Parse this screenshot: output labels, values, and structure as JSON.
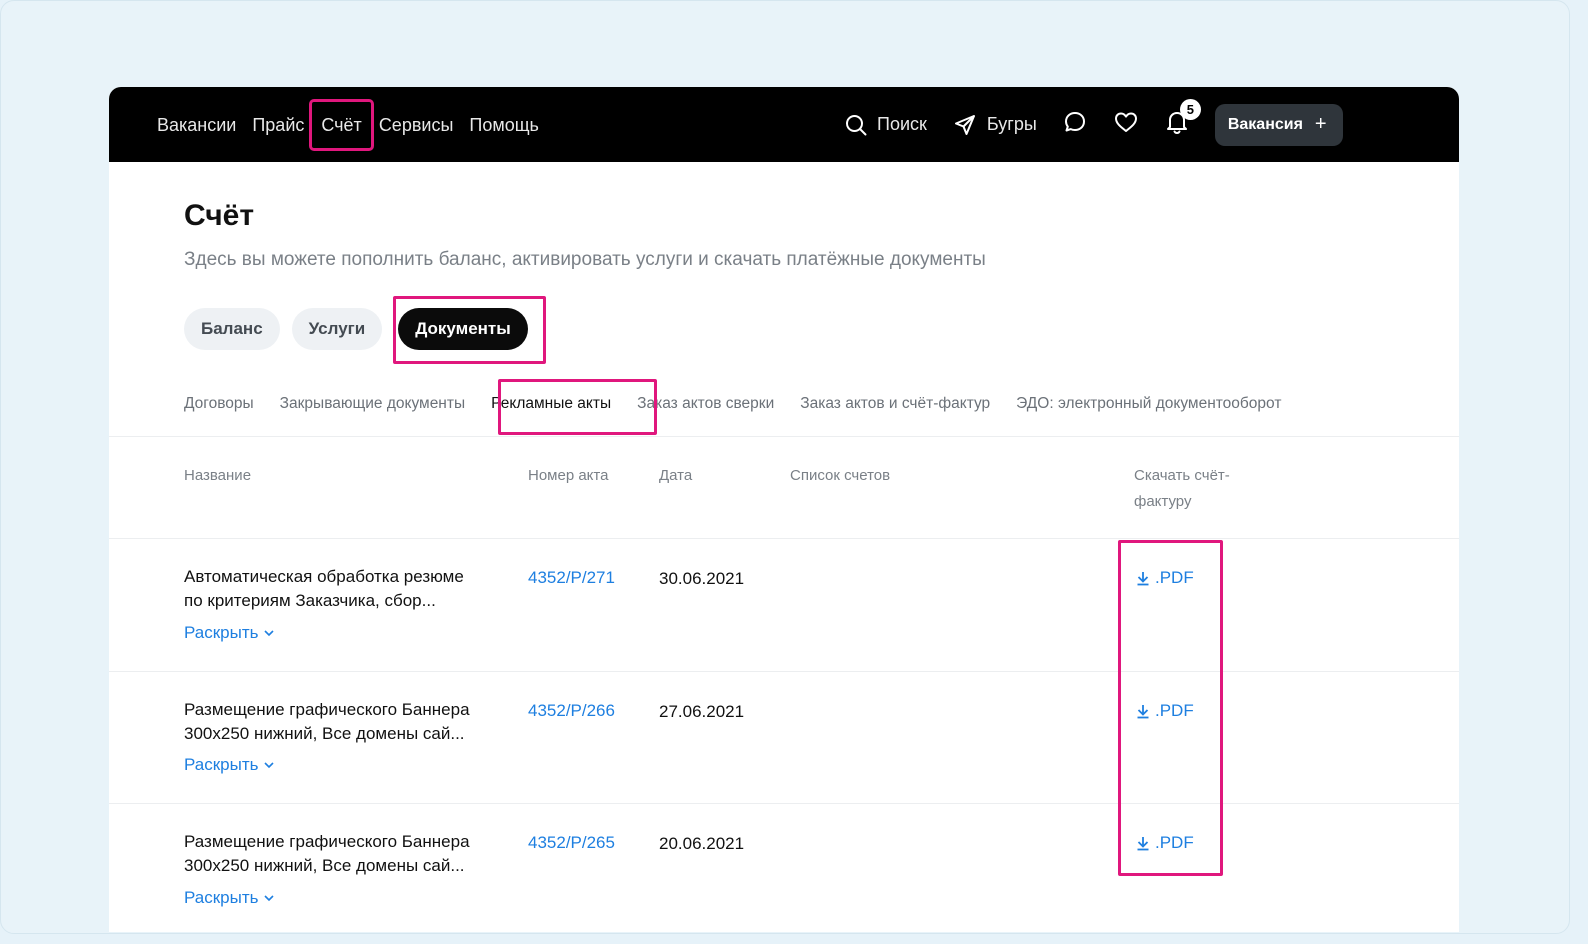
{
  "nav": {
    "items": [
      "Вакансии",
      "Прайс",
      "Счёт",
      "Сервисы",
      "Помощь"
    ]
  },
  "tools": {
    "search_label": "Поиск",
    "bugry_label": "Бугры",
    "notifications_count": "5",
    "vacancy_button_label": "Вакансия",
    "vacancy_button_plus": "+"
  },
  "page": {
    "title": "Счёт",
    "subtitle": "Здесь вы можете пополнить баланс, активировать услуги и скачать платёжные документы"
  },
  "pills": [
    "Баланс",
    "Услуги",
    "Документы"
  ],
  "subtabs": [
    "Договоры",
    "Закрывающие документы",
    "Рекламные акты",
    "Заказ актов сверки",
    "Заказ актов и счёт-фактур",
    "ЭДО: электронный документооборот"
  ],
  "table": {
    "headers": {
      "name": "Название",
      "act_number": "Номер акта",
      "date": "Дата",
      "invoices": "Список счетов",
      "download_line1": "Скачать счёт-",
      "download_line2": "фактуру"
    },
    "rows": [
      {
        "name_line1": "Автоматическая обработка резюме",
        "name_line2": "по критериям Заказчика, сбор...",
        "act_number": "4352/Р/271",
        "date": "30.06.2021",
        "expand": "Раскрыть",
        "pdf": ".PDF"
      },
      {
        "name_line1": "Размещение графического Баннера",
        "name_line2": "300x250 нижний, Все домены сай...",
        "act_number": "4352/Р/266",
        "date": "27.06.2021",
        "expand": "Раскрыть",
        "pdf": ".PDF"
      },
      {
        "name_line1": "Размещение графического Баннера",
        "name_line2": "300x250 нижний, Все домены сай...",
        "act_number": "4352/Р/265",
        "date": "20.06.2021",
        "expand": "Раскрыть",
        "pdf": ".PDF"
      }
    ]
  },
  "colors": {
    "highlight": "#e0177d",
    "link": "#1e7fe0",
    "topbar": "#000000",
    "background": "#e6f2f9"
  }
}
